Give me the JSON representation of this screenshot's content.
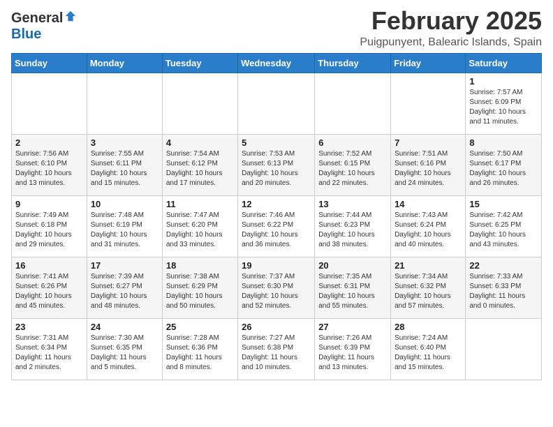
{
  "header": {
    "logo_general": "General",
    "logo_blue": "Blue",
    "month": "February 2025",
    "location": "Puigpunyent, Balearic Islands, Spain"
  },
  "weekdays": [
    "Sunday",
    "Monday",
    "Tuesday",
    "Wednesday",
    "Thursday",
    "Friday",
    "Saturday"
  ],
  "weeks": [
    [
      {
        "day": "",
        "info": ""
      },
      {
        "day": "",
        "info": ""
      },
      {
        "day": "",
        "info": ""
      },
      {
        "day": "",
        "info": ""
      },
      {
        "day": "",
        "info": ""
      },
      {
        "day": "",
        "info": ""
      },
      {
        "day": "1",
        "info": "Sunrise: 7:57 AM\nSunset: 6:09 PM\nDaylight: 10 hours\nand 11 minutes."
      }
    ],
    [
      {
        "day": "2",
        "info": "Sunrise: 7:56 AM\nSunset: 6:10 PM\nDaylight: 10 hours\nand 13 minutes."
      },
      {
        "day": "3",
        "info": "Sunrise: 7:55 AM\nSunset: 6:11 PM\nDaylight: 10 hours\nand 15 minutes."
      },
      {
        "day": "4",
        "info": "Sunrise: 7:54 AM\nSunset: 6:12 PM\nDaylight: 10 hours\nand 17 minutes."
      },
      {
        "day": "5",
        "info": "Sunrise: 7:53 AM\nSunset: 6:13 PM\nDaylight: 10 hours\nand 20 minutes."
      },
      {
        "day": "6",
        "info": "Sunrise: 7:52 AM\nSunset: 6:15 PM\nDaylight: 10 hours\nand 22 minutes."
      },
      {
        "day": "7",
        "info": "Sunrise: 7:51 AM\nSunset: 6:16 PM\nDaylight: 10 hours\nand 24 minutes."
      },
      {
        "day": "8",
        "info": "Sunrise: 7:50 AM\nSunset: 6:17 PM\nDaylight: 10 hours\nand 26 minutes."
      }
    ],
    [
      {
        "day": "9",
        "info": "Sunrise: 7:49 AM\nSunset: 6:18 PM\nDaylight: 10 hours\nand 29 minutes."
      },
      {
        "day": "10",
        "info": "Sunrise: 7:48 AM\nSunset: 6:19 PM\nDaylight: 10 hours\nand 31 minutes."
      },
      {
        "day": "11",
        "info": "Sunrise: 7:47 AM\nSunset: 6:20 PM\nDaylight: 10 hours\nand 33 minutes."
      },
      {
        "day": "12",
        "info": "Sunrise: 7:46 AM\nSunset: 6:22 PM\nDaylight: 10 hours\nand 36 minutes."
      },
      {
        "day": "13",
        "info": "Sunrise: 7:44 AM\nSunset: 6:23 PM\nDaylight: 10 hours\nand 38 minutes."
      },
      {
        "day": "14",
        "info": "Sunrise: 7:43 AM\nSunset: 6:24 PM\nDaylight: 10 hours\nand 40 minutes."
      },
      {
        "day": "15",
        "info": "Sunrise: 7:42 AM\nSunset: 6:25 PM\nDaylight: 10 hours\nand 43 minutes."
      }
    ],
    [
      {
        "day": "16",
        "info": "Sunrise: 7:41 AM\nSunset: 6:26 PM\nDaylight: 10 hours\nand 45 minutes."
      },
      {
        "day": "17",
        "info": "Sunrise: 7:39 AM\nSunset: 6:27 PM\nDaylight: 10 hours\nand 48 minutes."
      },
      {
        "day": "18",
        "info": "Sunrise: 7:38 AM\nSunset: 6:29 PM\nDaylight: 10 hours\nand 50 minutes."
      },
      {
        "day": "19",
        "info": "Sunrise: 7:37 AM\nSunset: 6:30 PM\nDaylight: 10 hours\nand 52 minutes."
      },
      {
        "day": "20",
        "info": "Sunrise: 7:35 AM\nSunset: 6:31 PM\nDaylight: 10 hours\nand 55 minutes."
      },
      {
        "day": "21",
        "info": "Sunrise: 7:34 AM\nSunset: 6:32 PM\nDaylight: 10 hours\nand 57 minutes."
      },
      {
        "day": "22",
        "info": "Sunrise: 7:33 AM\nSunset: 6:33 PM\nDaylight: 11 hours\nand 0 minutes."
      }
    ],
    [
      {
        "day": "23",
        "info": "Sunrise: 7:31 AM\nSunset: 6:34 PM\nDaylight: 11 hours\nand 2 minutes."
      },
      {
        "day": "24",
        "info": "Sunrise: 7:30 AM\nSunset: 6:35 PM\nDaylight: 11 hours\nand 5 minutes."
      },
      {
        "day": "25",
        "info": "Sunrise: 7:28 AM\nSunset: 6:36 PM\nDaylight: 11 hours\nand 8 minutes."
      },
      {
        "day": "26",
        "info": "Sunrise: 7:27 AM\nSunset: 6:38 PM\nDaylight: 11 hours\nand 10 minutes."
      },
      {
        "day": "27",
        "info": "Sunrise: 7:26 AM\nSunset: 6:39 PM\nDaylight: 11 hours\nand 13 minutes."
      },
      {
        "day": "28",
        "info": "Sunrise: 7:24 AM\nSunset: 6:40 PM\nDaylight: 11 hours\nand 15 minutes."
      },
      {
        "day": "",
        "info": ""
      }
    ]
  ]
}
